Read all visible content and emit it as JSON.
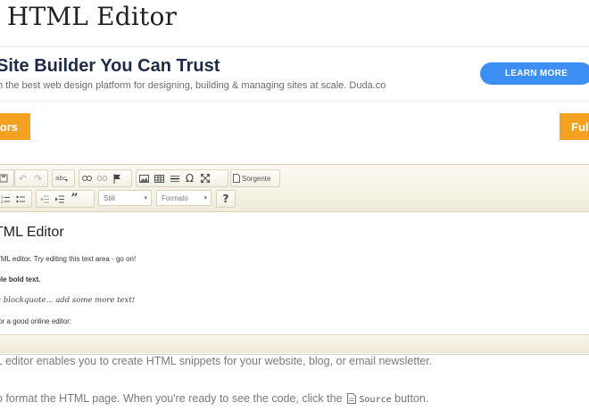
{
  "page_title": "e HTML Editor",
  "ad": {
    "title": "Site Builder You Can Trust",
    "subtitle": "n the best web design platform for designing, building & managing sites at scale. Duda.co",
    "button_label": "LEARN MORE"
  },
  "buttons": {
    "left_label": "tors",
    "right_label": "Full"
  },
  "toolbar": {
    "row1_icons": [
      "save-icon",
      "undo-icon",
      "redo-icon",
      "spellcheck-icon",
      "link-icon",
      "unlink-icon",
      "anchor-icon",
      "image-icon",
      "table-icon",
      "horizontal-line-icon",
      "special-char-icon",
      "maximize-icon",
      "source-icon"
    ],
    "source_label": "Sorgente",
    "row2_icons": [
      "numbered-list-icon",
      "bulleted-list-icon",
      "outdent-icon",
      "indent-icon",
      "blockquote-icon"
    ],
    "styles_label": "Stili",
    "format_label": "Formato",
    "help_label": "?"
  },
  "content": {
    "heading": "TML Editor",
    "line1": "TML editor. Try editing this text area - go on!",
    "line2": "ple bold text.",
    "line3": "e blockquote... add some more text!",
    "line4": "for a good online editor:"
  },
  "body": {
    "line1": "L editor enables you to create HTML snippets for your website, blog, or email newsletter.",
    "line2_pre": "o format the HTML page. When you're ready to see the code, click the",
    "line2_code": "Source",
    "line2_post": "button."
  }
}
